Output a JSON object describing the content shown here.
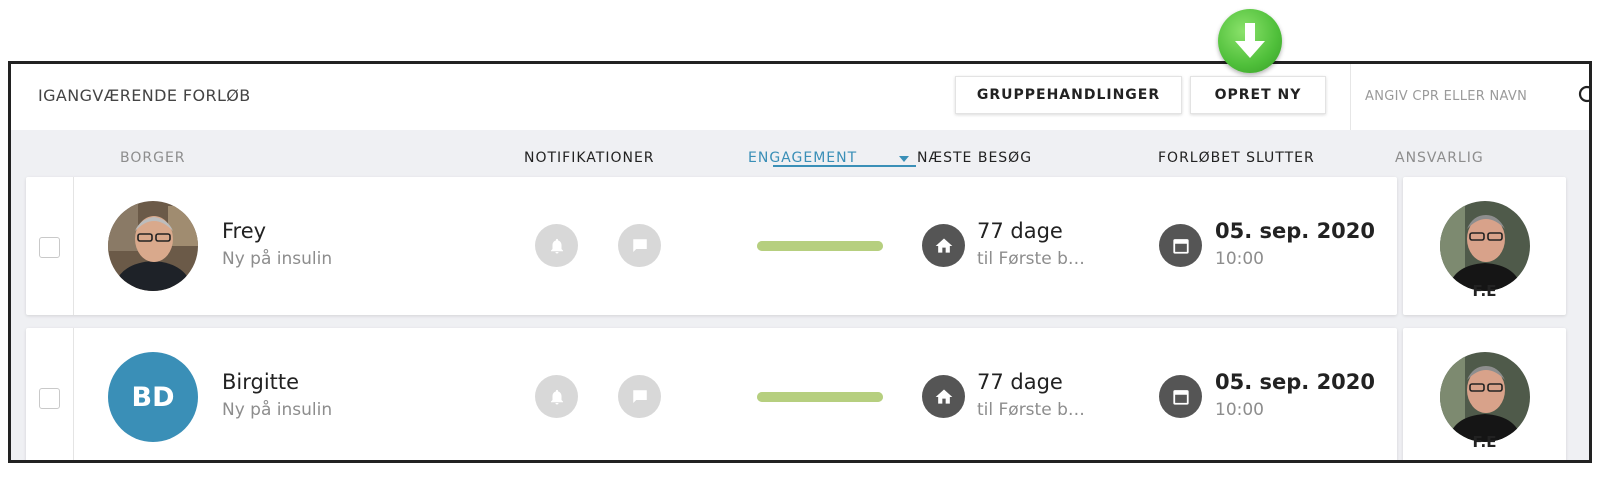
{
  "topbar": {
    "title": "IGANGVÆRENDE FORLØB",
    "group_actions_label": "GRUPPEHANDLINGER",
    "create_new_label": "OPRET NY",
    "search_placeholder": "ANGIV CPR ELLER NAVN"
  },
  "columns": {
    "citizen": "BORGER",
    "notifications": "NOTIFIKATIONER",
    "engagement": "ENGAGEMENT",
    "next_visit": "NÆSTE BESØG",
    "course_ends": "FORLØBET SLUTTER",
    "responsible": "ANSVARLIG"
  },
  "sort": {
    "column": "engagement",
    "direction": "descending"
  },
  "colors": {
    "accent": "#3a8fb7",
    "engagement": "#b6cf7f",
    "icon_dark": "#555555",
    "badge_green": "#4fbf3a"
  },
  "rows": [
    {
      "name": "Frey",
      "subtitle": "Ny på insulin",
      "avatar_type": "photo",
      "engagement": 1.0,
      "next_visit_days": "77 dage",
      "next_visit_detail": "til Første b…",
      "end_date": "05. sep. 2020",
      "end_time": "10:00",
      "responsible_initials": "F.E"
    },
    {
      "name": "Birgitte",
      "subtitle": "Ny på insulin",
      "avatar_type": "initials",
      "avatar_initials": "BD",
      "engagement": 1.0,
      "next_visit_days": "77 dage",
      "next_visit_detail": "til Første b…",
      "end_date": "05. sep. 2020",
      "end_time": "10:00",
      "responsible_initials": "F.E"
    }
  ],
  "icons": [
    "download-arrow-icon",
    "search-icon",
    "bell-icon",
    "chat-icon",
    "home-icon",
    "calendar-icon",
    "sort-down-icon"
  ]
}
